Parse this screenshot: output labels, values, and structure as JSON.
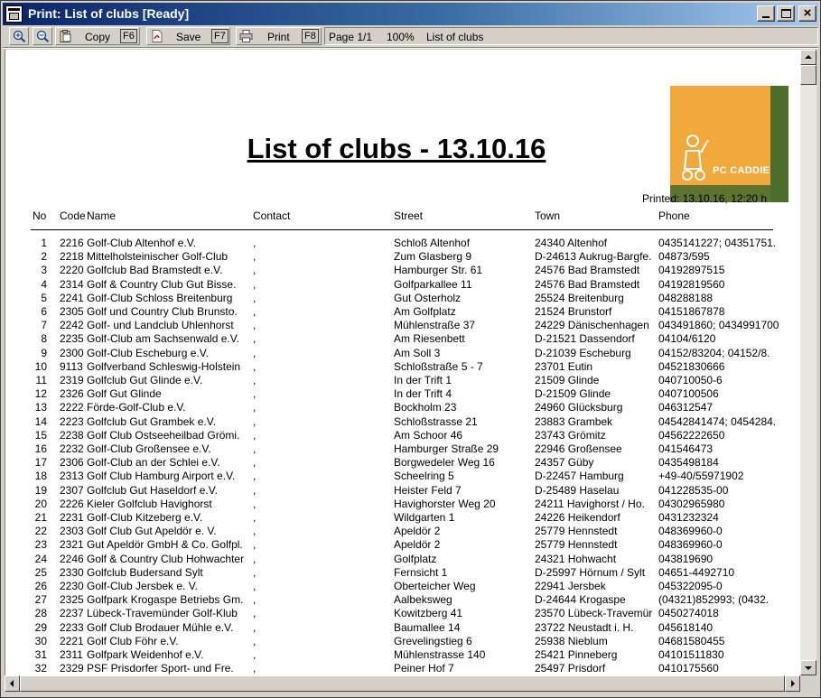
{
  "window": {
    "title": "Print: List of clubs [Ready]"
  },
  "toolbar": {
    "copy_label": "Copy",
    "copy_key": "F6",
    "save_label": "Save",
    "save_key": "F7",
    "print_label": "Print",
    "print_key": "F8",
    "page_info": "Page 1/1",
    "zoom": "100%",
    "doc_name": "List of clubs"
  },
  "report": {
    "title": "List of clubs - 13.10.16",
    "printed": "Printed: 13.10.16, 12:20 h",
    "logo_text": "PC CADDIE",
    "columns": {
      "no": "No",
      "code": "Code",
      "name": "Name",
      "contact": "Contact",
      "street": "Street",
      "town": "Town",
      "phone": "Phone"
    },
    "rows": [
      {
        "no": "1",
        "code": "2216",
        "name": "Golf-Club Altenhof e.V.",
        "contact": ",",
        "street": "Schloß Altenhof",
        "town": "24340 Altenhof",
        "phone": "0435141227; 04351751."
      },
      {
        "no": "2",
        "code": "2218",
        "name": "Mittelholsteinischer Golf-Club",
        "contact": ",",
        "street": "Zum Glasberg 9",
        "town": "D-24613 Aukrug-Bargfe.",
        "phone": "04873/595"
      },
      {
        "no": "3",
        "code": "2220",
        "name": "Golfclub Bad Bramstedt e.V.",
        "contact": ",",
        "street": "Hamburger Str. 61",
        "town": "24576 Bad Bramstedt",
        "phone": "04192897515"
      },
      {
        "no": "4",
        "code": "2314",
        "name": "Golf & Country Club Gut Bisse.",
        "contact": ",",
        "street": "Golfparkallee 11",
        "town": "24576 Bad Bramstedt",
        "phone": "04192819560"
      },
      {
        "no": "5",
        "code": "2241",
        "name": "Golf-Club Schloss Breitenburg",
        "contact": ",",
        "street": "Gut Osterholz",
        "town": "25524 Breitenburg",
        "phone": "048288188"
      },
      {
        "no": "6",
        "code": "2305",
        "name": "Golf und Country Club Brunsto.",
        "contact": ",",
        "street": "Am Golfplatz",
        "town": "21524 Brunstorf",
        "phone": "04151867878"
      },
      {
        "no": "7",
        "code": "2242",
        "name": "Golf- und Landclub Uhlenhorst",
        "contact": ",",
        "street": "Mühlenstraße 37",
        "town": "24229 Dänischenhagen",
        "phone": "043491860; 0434991700"
      },
      {
        "no": "8",
        "code": "2235",
        "name": "Golf-Club am Sachsenwald e.V.",
        "contact": ",",
        "street": "Am Riesenbett",
        "town": "D-21521 Dassendorf",
        "phone": "04104/6120"
      },
      {
        "no": "9",
        "code": "2300",
        "name": "Golf-Club Escheburg e.V.",
        "contact": ",",
        "street": "Am Soll 3",
        "town": "D-21039 Escheburg",
        "phone": "04152/83204; 04152/8."
      },
      {
        "no": "10",
        "code": "9113",
        "name": "Golfverband Schleswig-Holstein",
        "contact": ",",
        "street": "Schloßstraße 5 - 7",
        "town": "23701 Eutin",
        "phone": "04521830666"
      },
      {
        "no": "11",
        "code": "2319",
        "name": "Golfclub Gut Glinde e.V.",
        "contact": ",",
        "street": "In der Trift 1",
        "town": "21509 Glinde",
        "phone": "040710050-6"
      },
      {
        "no": "12",
        "code": "2326",
        "name": "Golf Gut Glinde",
        "contact": ",",
        "street": "In der Trift 4",
        "town": "D-21509 Glinde",
        "phone": "0407100506"
      },
      {
        "no": "13",
        "code": "2222",
        "name": "Förde-Golf-Club e.V.",
        "contact": ",",
        "street": "Bockholm 23",
        "town": "24960 Glücksburg",
        "phone": "046312547"
      },
      {
        "no": "14",
        "code": "2223",
        "name": "Golfclub Gut Grambek e.V.",
        "contact": ",",
        "street": "Schloßstrasse 21",
        "town": "23883 Grambek",
        "phone": "04542841474; 0454284."
      },
      {
        "no": "15",
        "code": "2238",
        "name": "Golf Club Ostseeheilbad Grömi.",
        "contact": ",",
        "street": "Am Schoor 46",
        "town": "23743 Grömitz",
        "phone": "04562222650"
      },
      {
        "no": "16",
        "code": "2232",
        "name": "Golf-Club Großensee e.V.",
        "contact": ",",
        "street": "Hamburger Straße 29",
        "town": "22946 Großensee",
        "phone": "041546473"
      },
      {
        "no": "17",
        "code": "2306",
        "name": "Golf-Club an der Schlei e.V.",
        "contact": ",",
        "street": "Borgwedeler Weg 16",
        "town": "24357 Güby",
        "phone": "0435498184"
      },
      {
        "no": "18",
        "code": "2313",
        "name": "Golf Club Hamburg Airport e.V.",
        "contact": ",",
        "street": "Scheelring 5",
        "town": "D-22457 Hamburg",
        "phone": "+49-40/55971902"
      },
      {
        "no": "19",
        "code": "2307",
        "name": "Golfclub Gut Haseldorf e.V.",
        "contact": ",",
        "street": "Heister Feld 7",
        "town": "D-25489 Haselau",
        "phone": "041228535-00"
      },
      {
        "no": "20",
        "code": "2226",
        "name": "Kieler Golfclub Havighorst",
        "contact": ",",
        "street": "Havighorster Weg 20",
        "town": "24211 Havighorst / Ho.",
        "phone": "04302965980"
      },
      {
        "no": "21",
        "code": "2231",
        "name": "Golf-Club Kitzeberg e.V.",
        "contact": ",",
        "street": "Wildgarten 1",
        "town": "24226 Heikendorf",
        "phone": "0431232324"
      },
      {
        "no": "22",
        "code": "2303",
        "name": "Golf Club Gut Apeldör e. V.",
        "contact": ",",
        "street": "Apeldör 2",
        "town": "25779 Hennstedt",
        "phone": "048369960-0"
      },
      {
        "no": "23",
        "code": "2321",
        "name": "Gut Apeldör GmbH & Co. Golfpl.",
        "contact": ",",
        "street": "Apeldör 2",
        "town": "25779 Hennstedt",
        "phone": "048369960-0"
      },
      {
        "no": "24",
        "code": "2246",
        "name": "Golf & Country Club Hohwachter",
        "contact": ",",
        "street": "Golfplatz",
        "town": "24321 Hohwacht",
        "phone": "043819690"
      },
      {
        "no": "25",
        "code": "2330",
        "name": "Golfclub Budersand Sylt",
        "contact": ",",
        "street": "Fernsicht 1",
        "town": "D-25997 Hörnum / Sylt",
        "phone": "04651-4492710"
      },
      {
        "no": "26",
        "code": "2230",
        "name": "Golf-Club Jersbek e. V.",
        "contact": ",",
        "street": "Oberteicher Weg",
        "town": "22941 Jersbek",
        "phone": "045322095-0"
      },
      {
        "no": "27",
        "code": "2325",
        "name": "Golfpark Krogaspe Betriebs Gm.",
        "contact": ",",
        "street": "Aalbeksweg",
        "town": "D-24644 Krogaspe",
        "phone": "(04321)852993; (0432."
      },
      {
        "no": "28",
        "code": "2237",
        "name": "Lübeck-Travemünder Golf-Klub",
        "contact": ",",
        "street": "Kowitzberg 41",
        "town": "23570 Lübeck-Travemür",
        "phone": "0450274018"
      },
      {
        "no": "29",
        "code": "2233",
        "name": "Golf Club Brodauer Mühle e.V.",
        "contact": ",",
        "street": "Baumallee 14",
        "town": "23722 Neustadt i. H.",
        "phone": "045618140"
      },
      {
        "no": "30",
        "code": "2221",
        "name": "Golf Club Föhr e.V.",
        "contact": ",",
        "street": "Grevelingstieg 6",
        "town": "25938 Nieblum",
        "phone": "04681580455"
      },
      {
        "no": "31",
        "code": "2311",
        "name": "Golfpark Weidenhof e.V.",
        "contact": ",",
        "street": "Mühlenstrasse 140",
        "town": "25421 Pinneberg",
        "phone": "04101511830"
      },
      {
        "no": "32",
        "code": "2329",
        "name": "PSF Prisdorfer Sport- und Fre.",
        "contact": ",",
        "street": "Peiner Hof 7",
        "town": "25497 Prisdorf",
        "phone": "0410175560"
      }
    ]
  }
}
